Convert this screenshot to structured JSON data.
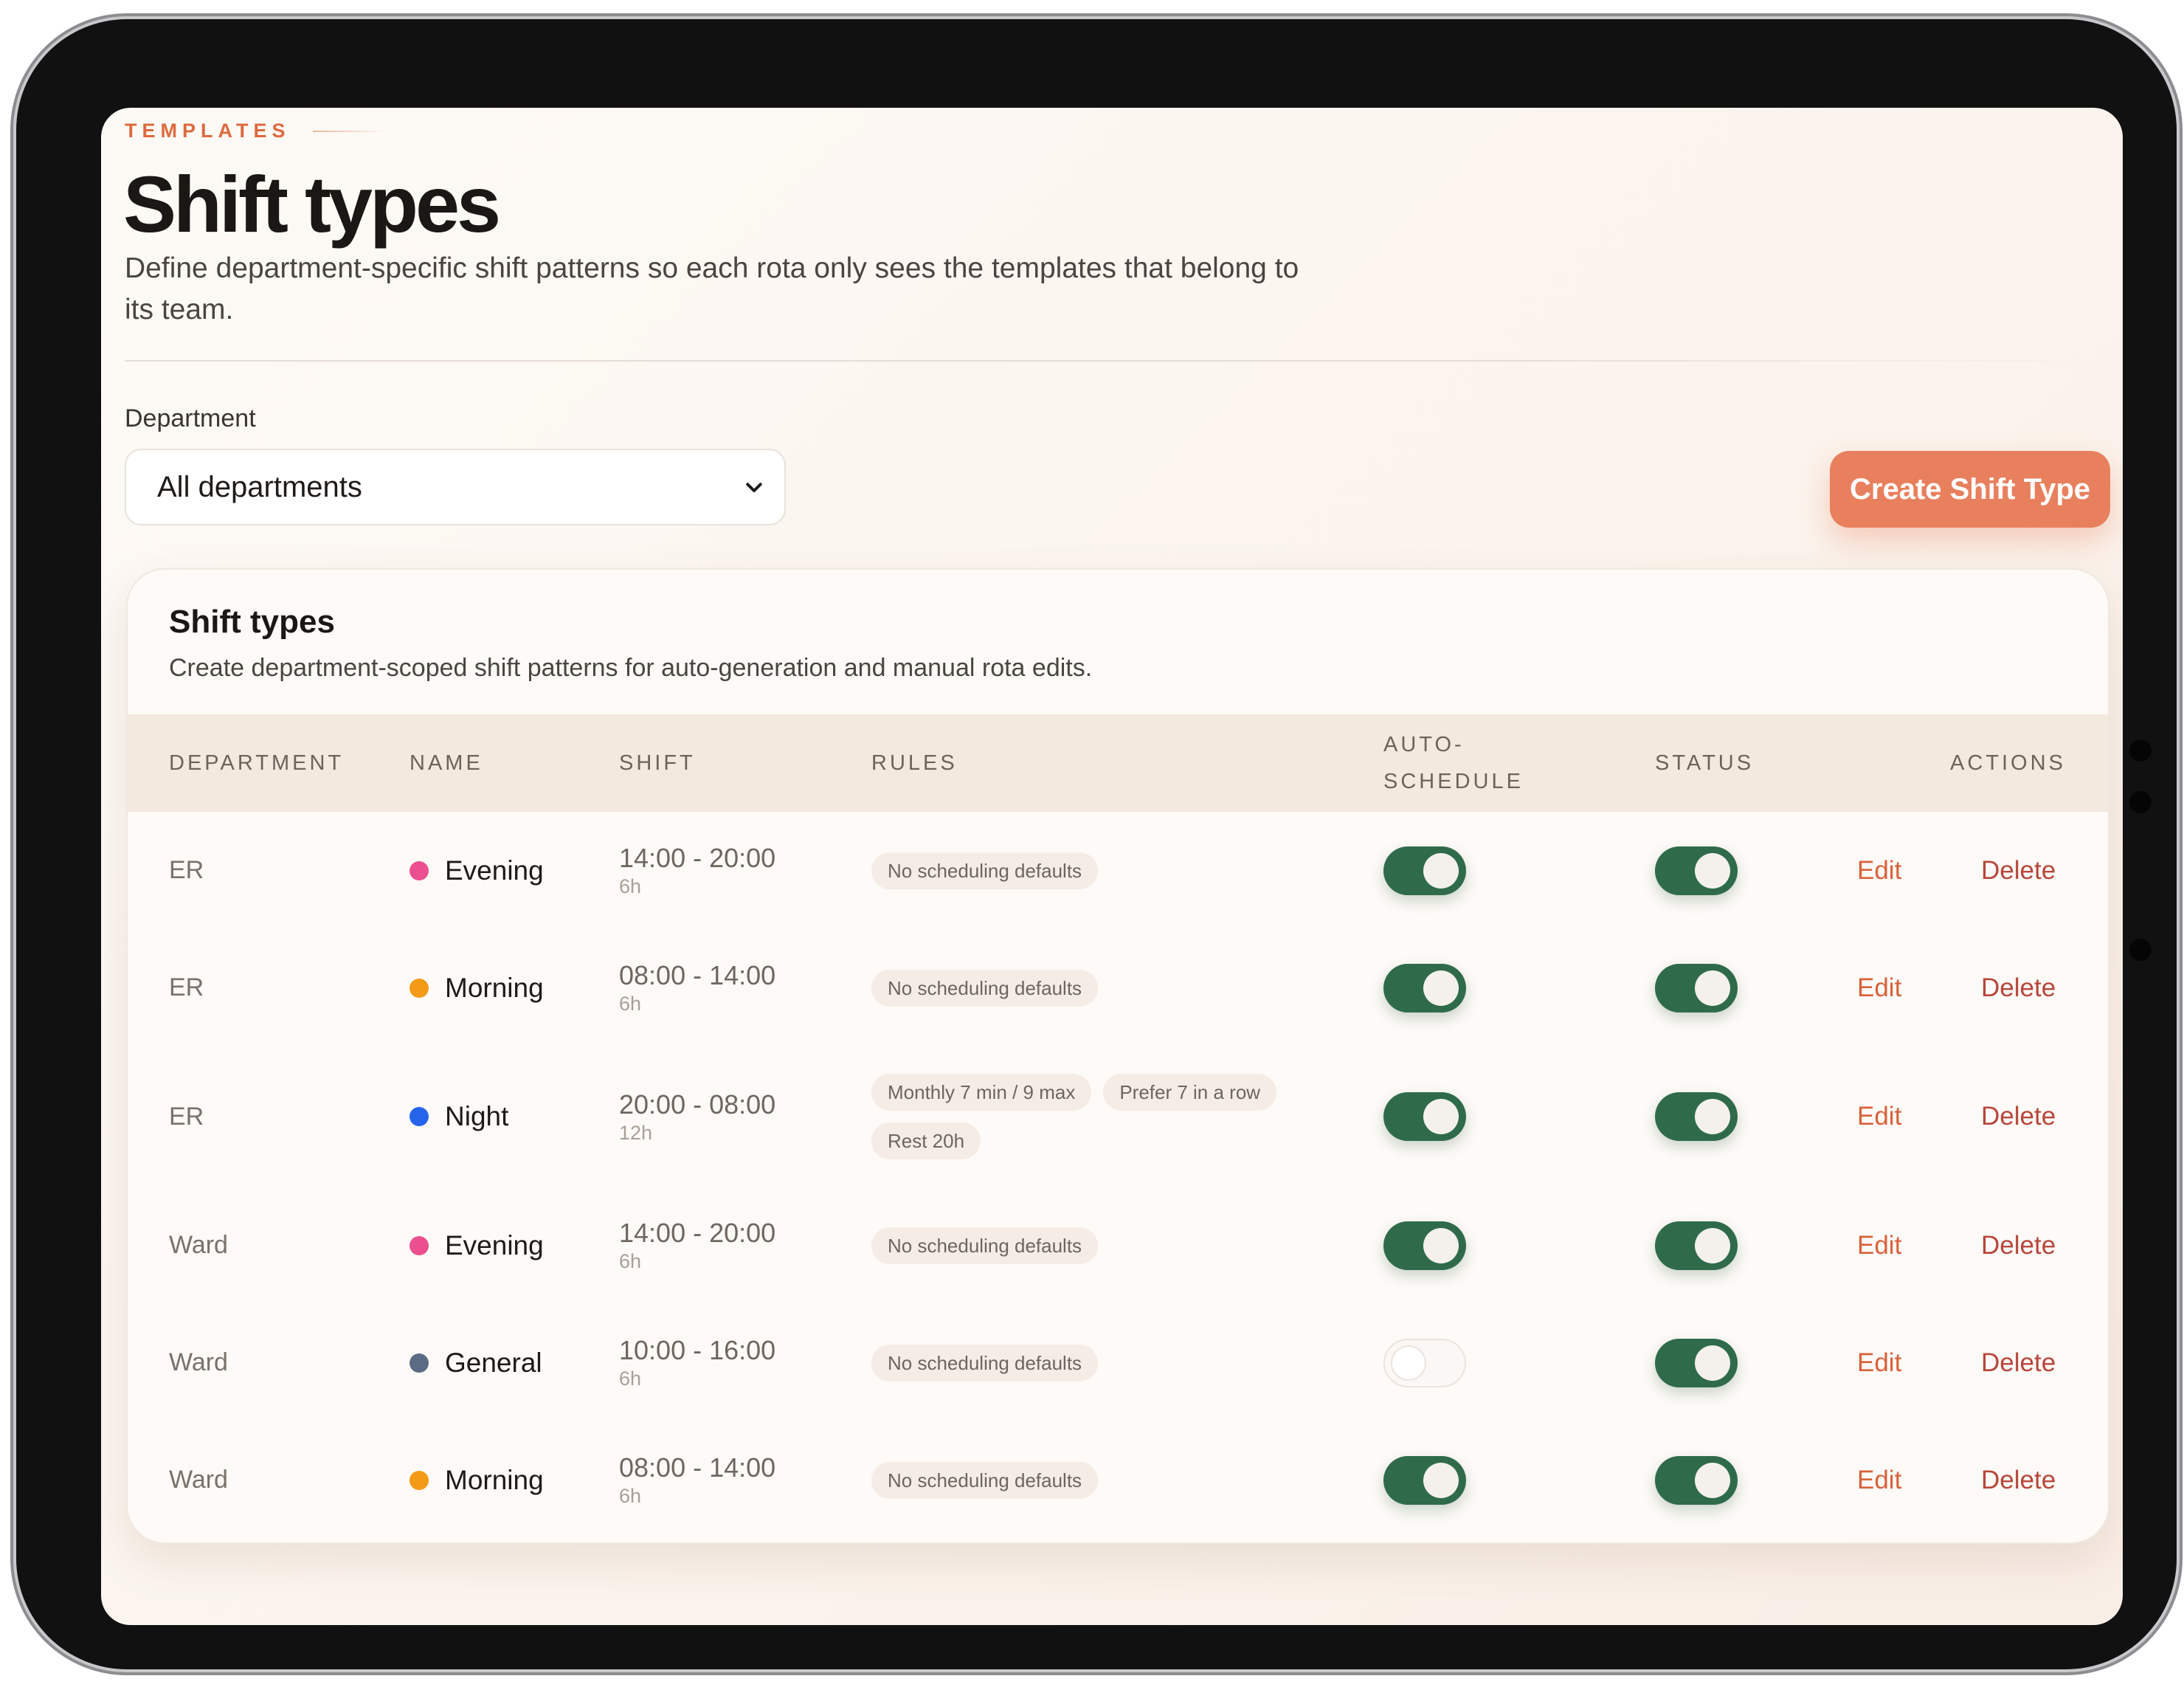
{
  "page": {
    "eyebrow": "TEMPLATES",
    "title": "Shift types",
    "description": "Define department-specific shift patterns so each rota only sees the templates that belong to its team."
  },
  "filter": {
    "label": "Department",
    "selected": "All departments"
  },
  "actions": {
    "create_label": "Create Shift Type"
  },
  "card": {
    "title": "Shift types",
    "subtitle": "Create department-scoped shift patterns for auto-generation and manual rota edits."
  },
  "table": {
    "headers": {
      "department": "DEPARTMENT",
      "name": "NAME",
      "shift": "SHIFT",
      "rules": "RULES",
      "auto_schedule": "AUTO-SCHEDULE",
      "status": "STATUS",
      "actions": "ACTIONS"
    },
    "edit_label": "Edit",
    "delete_label": "Delete",
    "rows": [
      {
        "department": "ER",
        "name": "Evening",
        "color": "#ec4f8f",
        "time": "14:00 - 20:00",
        "duration": "6h",
        "rules": [
          "No scheduling defaults"
        ],
        "auto_schedule": true,
        "status": true
      },
      {
        "department": "ER",
        "name": "Morning",
        "color": "#f39a16",
        "time": "08:00 - 14:00",
        "duration": "6h",
        "rules": [
          "No scheduling defaults"
        ],
        "auto_schedule": true,
        "status": true
      },
      {
        "department": "ER",
        "name": "Night",
        "color": "#2563eb",
        "time": "20:00 - 08:00",
        "duration": "12h",
        "rules": [
          "Monthly 7 min / 9 max",
          "Prefer 7 in a row",
          "Rest 20h"
        ],
        "auto_schedule": true,
        "status": true
      },
      {
        "department": "Ward",
        "name": "Evening",
        "color": "#ec4f8f",
        "time": "14:00 - 20:00",
        "duration": "6h",
        "rules": [
          "No scheduling defaults"
        ],
        "auto_schedule": true,
        "status": true
      },
      {
        "department": "Ward",
        "name": "General",
        "color": "#5a6b84",
        "time": "10:00 - 16:00",
        "duration": "6h",
        "rules": [
          "No scheduling defaults"
        ],
        "auto_schedule": false,
        "status": true
      },
      {
        "department": "Ward",
        "name": "Morning",
        "color": "#f39a16",
        "time": "08:00 - 14:00",
        "duration": "6h",
        "rules": [
          "No scheduling defaults"
        ],
        "auto_schedule": true,
        "status": true
      }
    ]
  }
}
